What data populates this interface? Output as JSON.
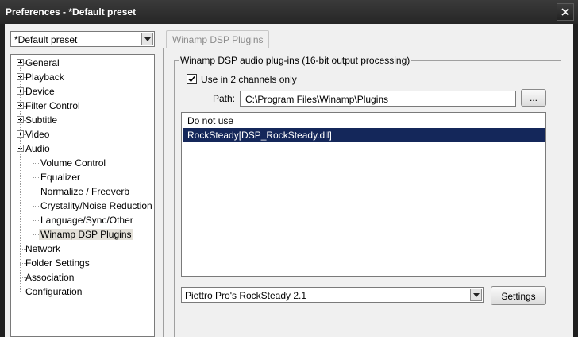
{
  "window": {
    "title": "Preferences - *Default preset"
  },
  "preset": {
    "selected": "*Default preset"
  },
  "tree": {
    "items": [
      {
        "label": "General",
        "expander": "plus"
      },
      {
        "label": "Playback",
        "expander": "plus"
      },
      {
        "label": "Device",
        "expander": "plus"
      },
      {
        "label": "Filter Control",
        "expander": "plus"
      },
      {
        "label": "Subtitle",
        "expander": "plus"
      },
      {
        "label": "Video",
        "expander": "plus"
      },
      {
        "label": "Audio",
        "expander": "minus"
      },
      {
        "label": "Volume Control"
      },
      {
        "label": "Equalizer"
      },
      {
        "label": "Normalize / Freeverb"
      },
      {
        "label": "Crystality/Noise Reduction"
      },
      {
        "label": "Language/Sync/Other"
      },
      {
        "label": "Winamp DSP Plugins",
        "selected": true
      },
      {
        "label": "Network"
      },
      {
        "label": "Folder Settings"
      },
      {
        "label": "Association"
      },
      {
        "label": "Configuration"
      }
    ]
  },
  "tab": {
    "label": "Winamp DSP Plugins"
  },
  "group": {
    "title": "Winamp DSP audio plug-ins (16-bit output processing)"
  },
  "options": {
    "use_2_channels_label": "Use in 2 channels only",
    "use_2_channels_checked": true
  },
  "path": {
    "label": "Path:",
    "value": "C:\\Program Files\\Winamp\\Plugins",
    "browse_label": "..."
  },
  "plugins": {
    "items": [
      {
        "label": "Do not use"
      },
      {
        "label": "RockSteady[DSP_RockSteady.dll]",
        "selected": true
      }
    ]
  },
  "module": {
    "selected": "Piettro Pro's RockSteady 2.1",
    "settings_label": "Settings"
  },
  "colors": {
    "selection_highlight": "#14275a",
    "tree_selection": "#e3e0d8",
    "titlebar": "#2e2e2e"
  },
  "icons": [
    "close-icon",
    "chevron-down-icon",
    "plus-icon",
    "minus-icon",
    "checkmark-icon"
  ]
}
